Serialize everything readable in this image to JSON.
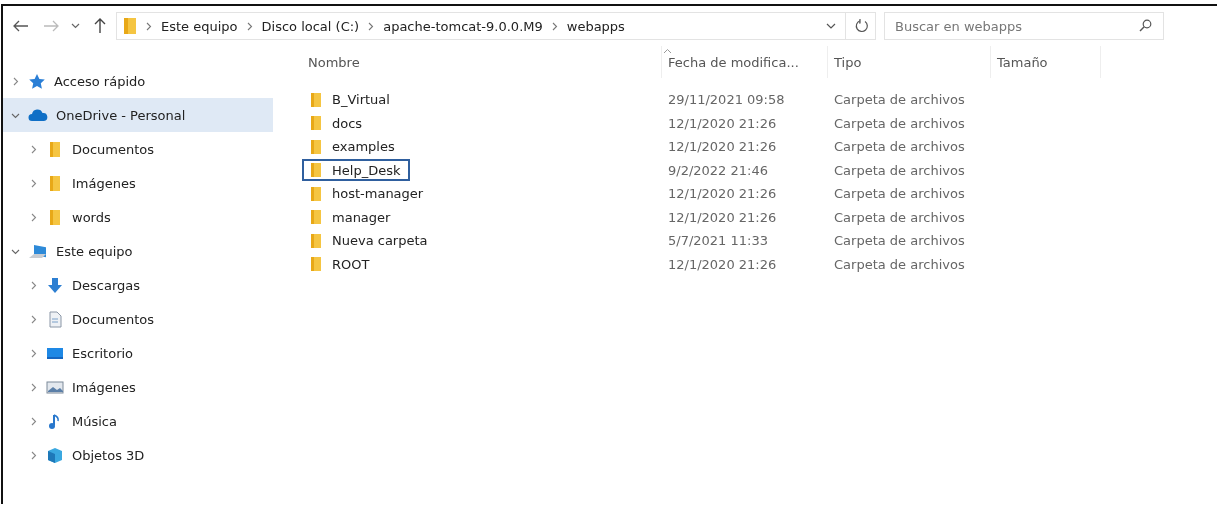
{
  "address_bar": {
    "path": [
      "Este equipo",
      "Disco local (C:)",
      "apache-tomcat-9.0.0.M9",
      "webapps"
    ]
  },
  "search": {
    "placeholder": "Buscar en webapps"
  },
  "sidebar": {
    "items": [
      {
        "label": "Acceso rápido",
        "kind": "star",
        "expanded": false,
        "selected": false
      },
      {
        "label": "OneDrive - Personal",
        "kind": "cloud",
        "expanded": true,
        "selected": true,
        "children": [
          {
            "label": "Documentos",
            "kind": "folder",
            "expanded": false,
            "selected": false
          },
          {
            "label": "Imágenes",
            "kind": "folder",
            "expanded": false,
            "selected": false
          },
          {
            "label": "words",
            "kind": "folder",
            "expanded": false,
            "selected": false
          }
        ]
      },
      {
        "label": "Este equipo",
        "kind": "pc",
        "expanded": true,
        "selected": false,
        "children": [
          {
            "label": "Descargas",
            "kind": "download",
            "expanded": false,
            "selected": false
          },
          {
            "label": "Documentos",
            "kind": "document",
            "expanded": false,
            "selected": false
          },
          {
            "label": "Escritorio",
            "kind": "desktop",
            "expanded": false,
            "selected": false
          },
          {
            "label": "Imágenes",
            "kind": "pictures",
            "expanded": false,
            "selected": false
          },
          {
            "label": "Música",
            "kind": "music",
            "expanded": false,
            "selected": false
          },
          {
            "label": "Objetos 3D",
            "kind": "objects3d",
            "expanded": false,
            "selected": false
          }
        ]
      }
    ]
  },
  "table": {
    "columns": [
      "Nombre",
      "Fecha de modifica...",
      "Tipo",
      "Tamaño"
    ],
    "rows": [
      {
        "name": "B_Virtual",
        "date": "29/11/2021 09:58",
        "type": "Carpeta de archivos",
        "focused": false
      },
      {
        "name": "docs",
        "date": "12/1/2020 21:26",
        "type": "Carpeta de archivos",
        "focused": false
      },
      {
        "name": "examples",
        "date": "12/1/2020 21:26",
        "type": "Carpeta de archivos",
        "focused": false
      },
      {
        "name": "Help_Desk",
        "date": "9/2/2022 21:46",
        "type": "Carpeta de archivos",
        "focused": true
      },
      {
        "name": "host-manager",
        "date": "12/1/2020 21:26",
        "type": "Carpeta de archivos",
        "focused": false
      },
      {
        "name": "manager",
        "date": "12/1/2020 21:26",
        "type": "Carpeta de archivos",
        "focused": false
      },
      {
        "name": "Nueva carpeta",
        "date": "5/7/2021 11:33",
        "type": "Carpeta de archivos",
        "focused": false
      },
      {
        "name": "ROOT",
        "date": "12/1/2020 21:26",
        "type": "Carpeta de archivos",
        "focused": false
      }
    ]
  }
}
